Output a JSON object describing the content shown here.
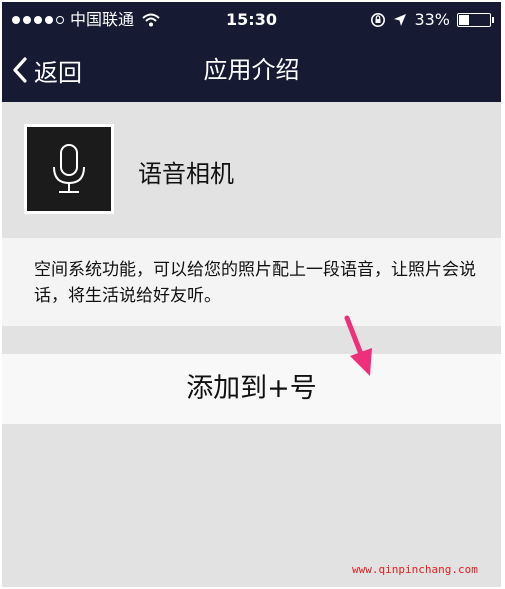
{
  "status_bar": {
    "carrier": "中国联通",
    "time": "15:30",
    "battery_text": "33%",
    "battery_level": 0.33,
    "signal_bars_filled": 4,
    "signal_bars_total": 5
  },
  "nav": {
    "back_label": "返回",
    "title": "应用介绍"
  },
  "app": {
    "name": "语音相机",
    "icon": "microphone-icon",
    "description": "空间系统功能，可以给您的照片配上一段语音，让照片会说话，将生活说给好友听。"
  },
  "actions": {
    "add_label": "添加到+号"
  },
  "annotation": {
    "arrow_color": "#ee2f79"
  },
  "watermark": "www.qinpinchang.com",
  "colors": {
    "nav_bg": "#161a33",
    "page_bg": "#e2e2e2"
  }
}
